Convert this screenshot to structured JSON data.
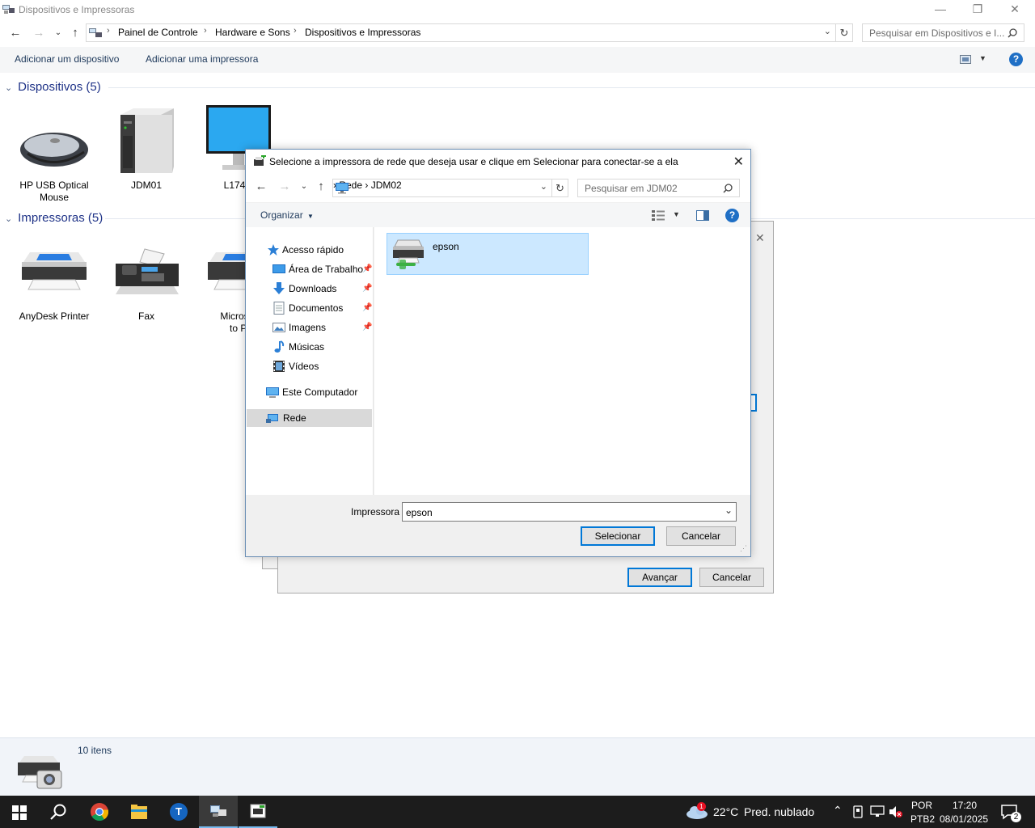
{
  "window": {
    "title": "Dispositivos e Impressoras",
    "minimize_icon": "minimize-icon",
    "restore_icon": "restore-icon",
    "close_icon": "close-icon"
  },
  "address": {
    "breadcrumbs": [
      "Painel de Controle",
      "Hardware e Sons",
      "Dispositivos e Impressoras"
    ],
    "search_placeholder": "Pesquisar em Dispositivos e I..."
  },
  "commands": {
    "add_device": "Adicionar um dispositivo",
    "add_printer": "Adicionar uma impressora"
  },
  "devices_group": {
    "header": "Dispositivos (5)",
    "items": [
      {
        "label_line1": "HP USB Optical",
        "label_line2": "Mouse",
        "icon": "mouse-icon"
      },
      {
        "label_line1": "JDM01",
        "label_line2": "",
        "icon": "computer-tower-icon"
      },
      {
        "label_line1": "L174",
        "label_line2": "",
        "icon": "monitor-icon"
      }
    ]
  },
  "printers_group": {
    "header": "Impressoras (5)",
    "items": [
      {
        "label_line1": "AnyDesk Printer",
        "label_line2": "",
        "icon": "printer-icon"
      },
      {
        "label_line1": "Fax",
        "label_line2": "",
        "icon": "fax-icon"
      },
      {
        "label_line1": "Microsof",
        "label_line2": "to PD",
        "icon": "printer-icon"
      }
    ]
  },
  "status": {
    "count": "10 itens"
  },
  "wizard": {
    "next_button": "Avançar",
    "cancel_button": "Cancelar"
  },
  "dialog": {
    "title": "Selecione a impressora de rede que deseja usar e clique em Selecionar para conectar-se a ela",
    "breadcrumbs": [
      "Rede",
      "JDM02"
    ],
    "search_placeholder": "Pesquisar em JDM02",
    "organize": "Organizar",
    "nav": {
      "quick_access": "Acesso rápido",
      "items": [
        {
          "label": "Área de Trabalho",
          "icon": "desktop-icon",
          "pinned": true
        },
        {
          "label": "Downloads",
          "icon": "download-icon",
          "pinned": true
        },
        {
          "label": "Documentos",
          "icon": "documents-icon",
          "pinned": true
        },
        {
          "label": "Imagens",
          "icon": "pictures-icon",
          "pinned": true
        },
        {
          "label": "Músicas",
          "icon": "music-icon",
          "pinned": false
        },
        {
          "label": "Vídeos",
          "icon": "videos-icon",
          "pinned": false
        }
      ],
      "this_pc": "Este Computador",
      "network": "Rede"
    },
    "files": [
      {
        "name": "epson",
        "icon": "network-printer-icon",
        "selected": true
      }
    ],
    "printer_label": "Impressora",
    "printer_value": "epson",
    "select_button": "Selecionar",
    "cancel_button": "Cancelar"
  },
  "taskbar": {
    "weather_badge": "1",
    "temperature": "22°C",
    "weather": "Pred. nublado",
    "lang_top": "POR",
    "lang_bottom": "PTB2",
    "time": "17:20",
    "date": "08/01/2025",
    "notifications": "2"
  },
  "colors": {
    "accent": "#0078d7",
    "group_header": "#1e3287",
    "selection": "#cce8ff",
    "taskbar": "#1c1c1c"
  }
}
